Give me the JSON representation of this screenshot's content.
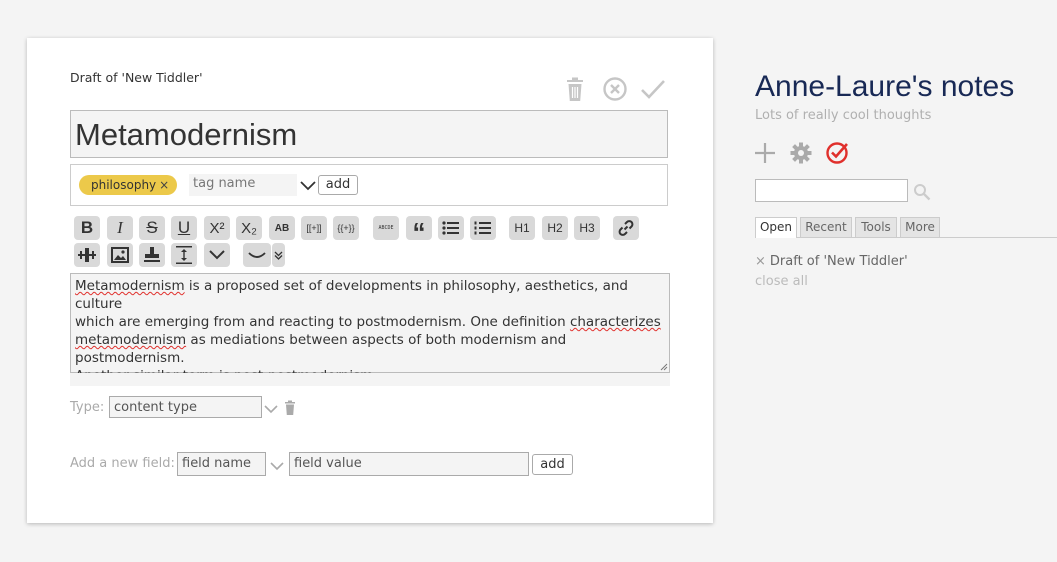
{
  "tiddler": {
    "draft_label": "Draft of 'New Tiddler'",
    "title_value": "Metamodernism",
    "tags": [
      {
        "label": "philosophy",
        "remove": "×"
      }
    ],
    "tag_input_placeholder": "tag name",
    "tag_add_label": "add",
    "toolbar": {
      "row1": [
        {
          "name": "bold",
          "glyph": "B"
        },
        {
          "name": "italic",
          "glyph": "I"
        },
        {
          "name": "strikethrough",
          "glyph": "S"
        },
        {
          "name": "underline",
          "glyph": "U"
        },
        {
          "name": "superscript",
          "glyph": "X²"
        },
        {
          "name": "subscript",
          "glyph": "X₂"
        },
        {
          "name": "smallcaps",
          "glyph": "AB"
        },
        {
          "name": "link-wiki",
          "glyph": "[[+]]"
        },
        {
          "name": "transclude",
          "glyph": "{{+}}"
        },
        {
          "name": "monospace",
          "glyph": "ABCDE"
        },
        {
          "name": "quote",
          "glyph": "“"
        },
        {
          "name": "bullet-list",
          "glyph": "≡"
        },
        {
          "name": "numbered-list",
          "glyph": "≡"
        },
        {
          "name": "heading-1",
          "glyph": "H1"
        },
        {
          "name": "heading-2",
          "glyph": "H2"
        },
        {
          "name": "heading-3",
          "glyph": "H3"
        },
        {
          "name": "link",
          "glyph": "🔗"
        }
      ],
      "row2": [
        "excise",
        "picture",
        "stamp",
        "size",
        "more-dropdown",
        "preview"
      ]
    },
    "body_lines": [
      [
        {
          "t": "Metamodernism",
          "sp": true
        },
        {
          "t": " is a proposed set of developments in philosophy, aesthetics, and culture"
        }
      ],
      [
        {
          "t": "which are emerging from and reacting to postmodernism. One definition "
        },
        {
          "t": "characterizes",
          "sp": true
        }
      ],
      [
        {
          "t": "metamodernism",
          "sp": true
        },
        {
          "t": " as mediations between aspects of both modernism and postmodernism."
        }
      ],
      [
        {
          "t": "Another similar term is post-postmodernism."
        }
      ]
    ],
    "type_label": "Type:",
    "type_placeholder": "content type",
    "new_field_label": "Add a new field:",
    "field_name_placeholder": "field name",
    "field_value_placeholder": "field value",
    "field_add_label": "add"
  },
  "sidebar": {
    "site_title": "Anne-Laure's notes",
    "site_subtitle": "Lots of really cool thoughts",
    "tabs": [
      "Open",
      "Recent",
      "Tools",
      "More"
    ],
    "open_items": [
      {
        "close": "×",
        "label": "Draft of 'New Tiddler'"
      }
    ],
    "close_all": "close all",
    "accent_red": "#e0302c"
  }
}
